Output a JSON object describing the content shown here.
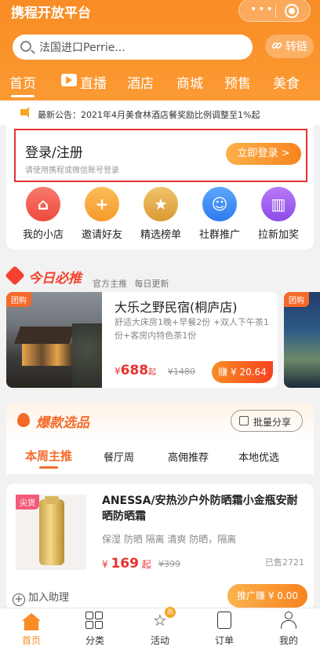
{
  "header": {
    "app_title": "携程开放平台",
    "search_value": "法国进口Perrie...",
    "zhuanlian_label": "转链"
  },
  "tabs": [
    "首页",
    "直播",
    "酒店",
    "商城",
    "预售",
    "美食"
  ],
  "announcement": "最新公告：2021年4月美食林酒店餐奖励比例调整至1%起",
  "login": {
    "title": "登录/注册",
    "subtitle": "请使用携程或微信账号登录",
    "button": "立即登录 >"
  },
  "shortcuts": [
    {
      "label": "我的小店",
      "icon": "shop-icon",
      "color": "#f25a4e"
    },
    {
      "label": "邀请好友",
      "icon": "invite-user-icon",
      "color": "#f7a23a"
    },
    {
      "label": "精选榜单",
      "icon": "medal-icon",
      "color": "#e2a945"
    },
    {
      "label": "社群推广",
      "icon": "community-icon",
      "color": "#3e8ef7"
    },
    {
      "label": "拉新加奖",
      "icon": "building-icon",
      "color": "#a05ef0"
    }
  ],
  "today": {
    "title": "今日必推",
    "tags": "官方主推 每日更新",
    "hotel": {
      "tag": "团购",
      "name": "大乐之野民宿(桐庐店)",
      "desc": "舒适大床房1晚+早餐2份 +双人下午茶1份+客房内特色茶1份",
      "currency": "¥",
      "price": "688",
      "unit": "起",
      "old_price": "¥1480",
      "earn": "赚 ¥ 20.64"
    },
    "next_tag": "团购"
  },
  "hot": {
    "title": "爆款选品",
    "share_label": "批量分享",
    "subtabs": [
      "本周主推",
      "餐厅周",
      "高佣推荐",
      "本地优选"
    ]
  },
  "product": {
    "tag": "尖货",
    "name": "ANESSA/安热沙户外防晒霜小金瓶安耐晒防晒霜",
    "tags": "保湿 防晒 隔离 清爽 防晒，隔离",
    "currency": "¥",
    "price": "169",
    "unit": "起",
    "old_price": "¥399",
    "sold": "已售2721",
    "add_helper": "加入助理",
    "promote": "推广赚 ¥ 0.00"
  },
  "bottom_nav": [
    {
      "label": "首页",
      "icon": "home-icon"
    },
    {
      "label": "分类",
      "icon": "grid-icon"
    },
    {
      "label": "活动",
      "icon": "star-icon",
      "badge": "热"
    },
    {
      "label": "订单",
      "icon": "order-icon"
    },
    {
      "label": "我的",
      "icon": "user-icon"
    }
  ],
  "colors": {
    "brand": "#f98c24",
    "price": "#e8312f",
    "highlight_border": "#e53333"
  }
}
